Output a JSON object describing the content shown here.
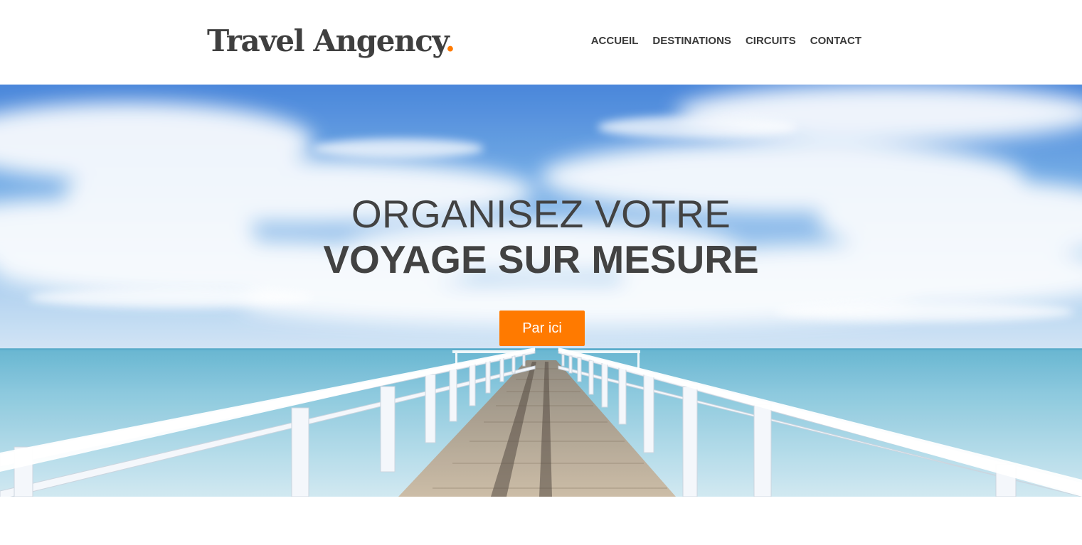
{
  "brand": {
    "name": "Travel Angency",
    "dot": ".",
    "accent_color": "#ff7a00"
  },
  "nav": {
    "items": [
      {
        "label": "ACCUEIL"
      },
      {
        "label": "DESTINATIONS"
      },
      {
        "label": "CIRCUITS"
      },
      {
        "label": "CONTACT"
      }
    ]
  },
  "hero": {
    "title_line1": "ORGANISEZ VOTRE",
    "title_line2": "VOYAGE SUR MESURE",
    "cta_label": "Par ici",
    "background_image": "sunny sea pier with white railings under blue sky"
  }
}
